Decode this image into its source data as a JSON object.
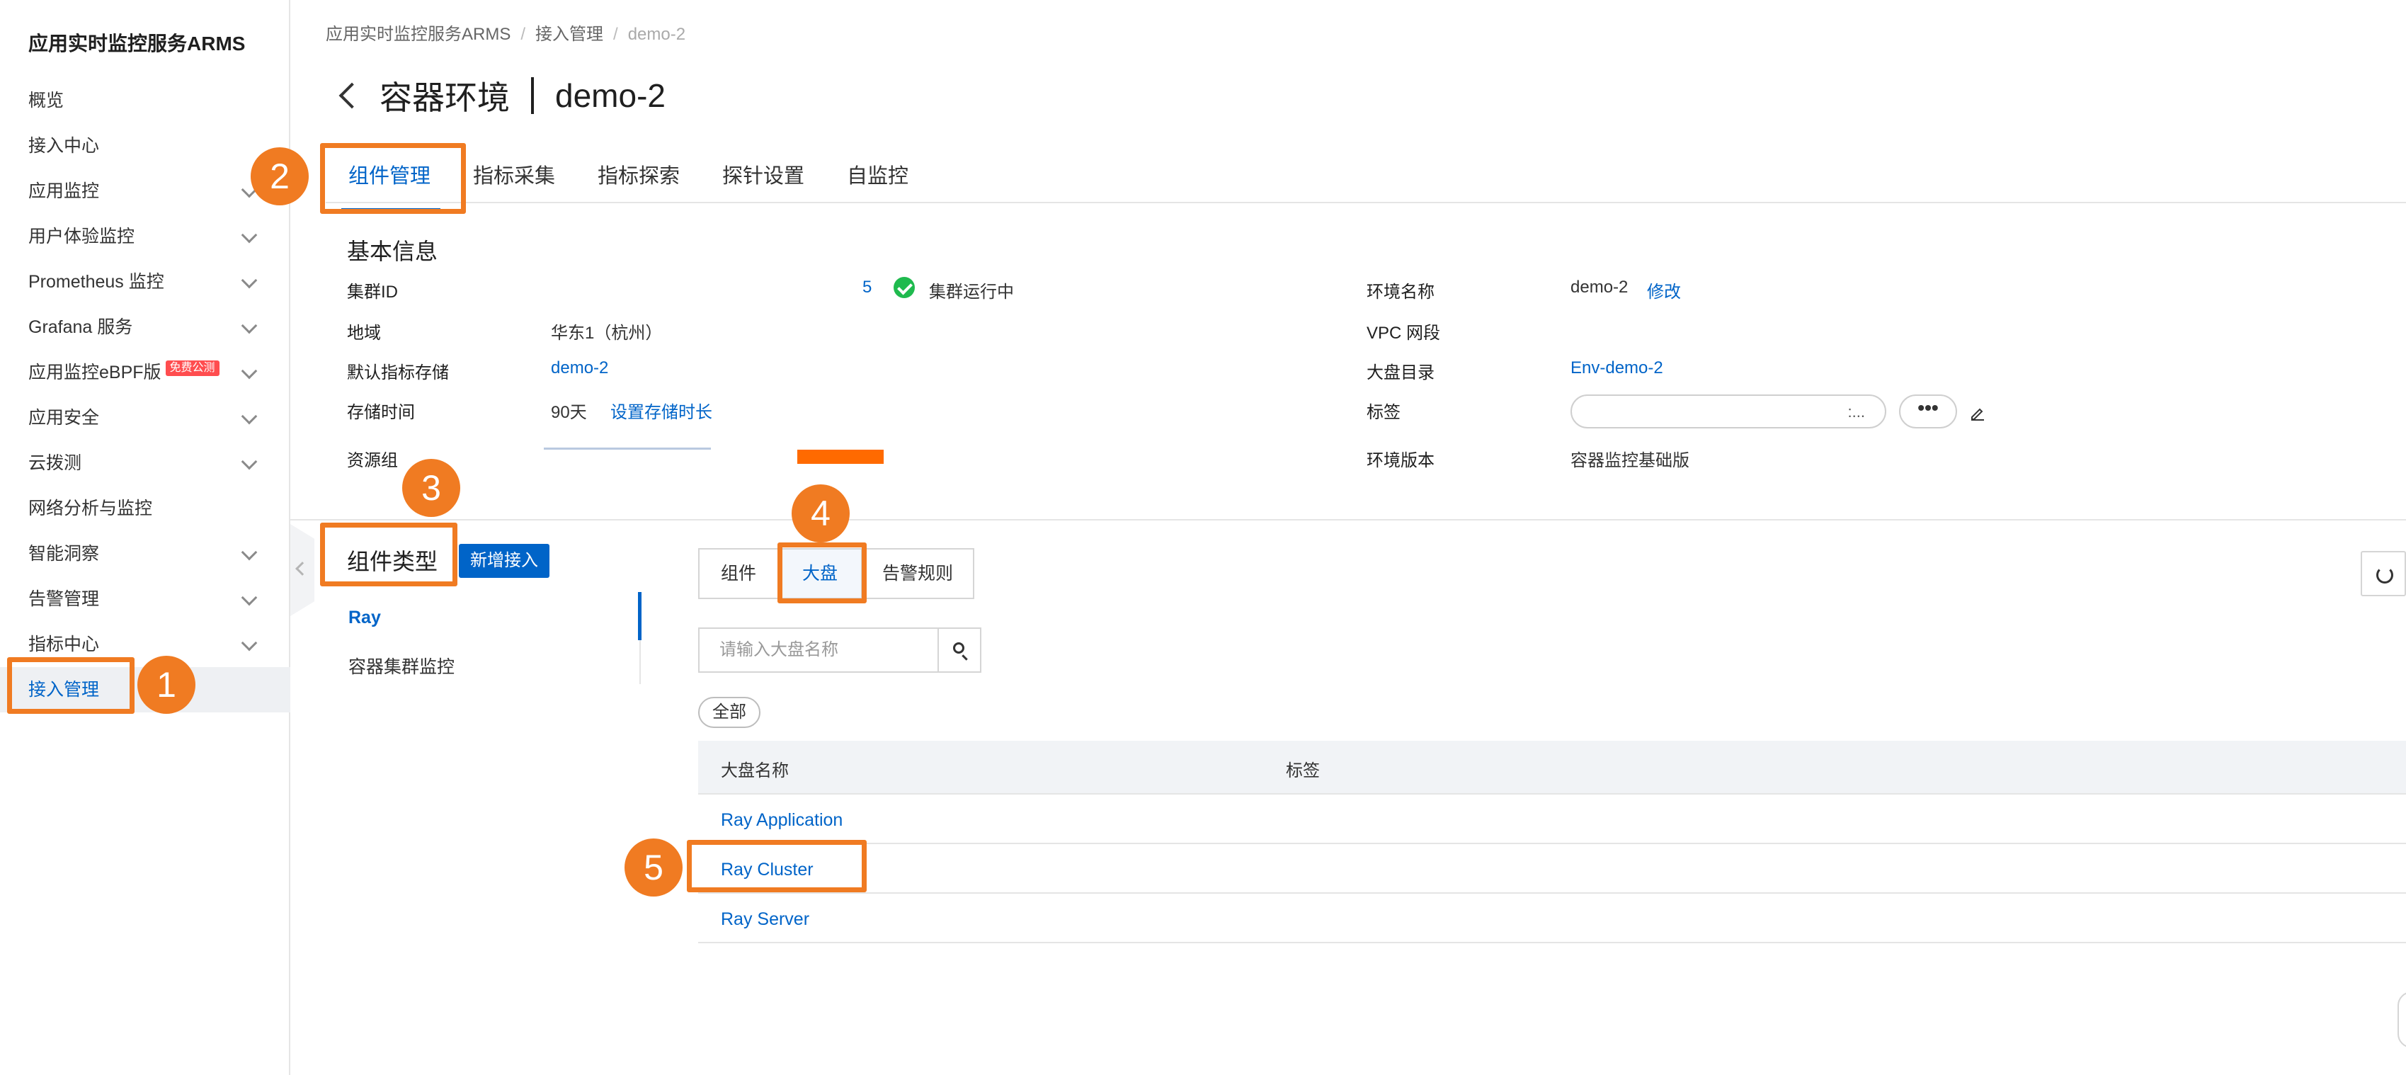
{
  "sidebar": {
    "title": "应用实时监控服务ARMS",
    "items": [
      {
        "label": "概览"
      },
      {
        "label": "接入中心"
      },
      {
        "label": "应用监控"
      },
      {
        "label": "用户体验监控"
      },
      {
        "label": "Prometheus 监控"
      },
      {
        "label": "Grafana 服务"
      },
      {
        "label": "应用监控eBPF版",
        "badge": "免费公测"
      },
      {
        "label": "应用安全"
      },
      {
        "label": "云拨测"
      },
      {
        "label": "网络分析与监控"
      },
      {
        "label": "智能洞察"
      },
      {
        "label": "告警管理"
      },
      {
        "label": "指标中心"
      },
      {
        "label": "接入管理"
      }
    ]
  },
  "breadcrumb": [
    "应用实时监控服务ARMS",
    "接入管理",
    "demo-2"
  ],
  "header": {
    "title": "容器环境",
    "subtitle": "demo-2"
  },
  "tabs": [
    "组件管理",
    "指标采集",
    "指标探索",
    "探针设置",
    "自监控"
  ],
  "basic_info": {
    "title": "基本信息",
    "cluster_id_label": "集群ID",
    "cluster_id_value": "5",
    "cluster_status": "集群运行中",
    "region_label": "地域",
    "region_value": "华东1（杭州）",
    "storage_label": "默认指标存储",
    "storage_value": "demo-2",
    "retention_label": "存储时间",
    "retention_value": "90天",
    "retention_link": "设置存储时长",
    "resource_group_label": "资源组",
    "env_name_label": "环境名称",
    "env_name_value": "demo-2",
    "env_name_edit": "修改",
    "vpc_label": "VPC 网段",
    "dashboard_dir_label": "大盘目录",
    "dashboard_dir_value": "Env-demo-2",
    "tags_label": "标签",
    "tags_value": ":...",
    "more_label": "•••",
    "env_version_label": "环境版本",
    "env_version_value": "容器监控基础版"
  },
  "component": {
    "title": "组件类型",
    "add_button": "新增接入",
    "types": [
      "Ray",
      "容器集群监控"
    ]
  },
  "segments": [
    "组件",
    "大盘",
    "告警规则"
  ],
  "search": {
    "placeholder": "请输入大盘名称"
  },
  "filter_all": "全部",
  "table": {
    "headers": [
      "大盘名称",
      "标签"
    ],
    "rows": [
      "Ray Application",
      "Ray Cluster",
      "Ray Server"
    ]
  },
  "markers": [
    "1",
    "2",
    "3",
    "4",
    "5"
  ],
  "colors": {
    "accent": "#0064c8",
    "highlight": "#f07b22",
    "success": "#1fba4e",
    "badge": "#ff4d4f"
  }
}
